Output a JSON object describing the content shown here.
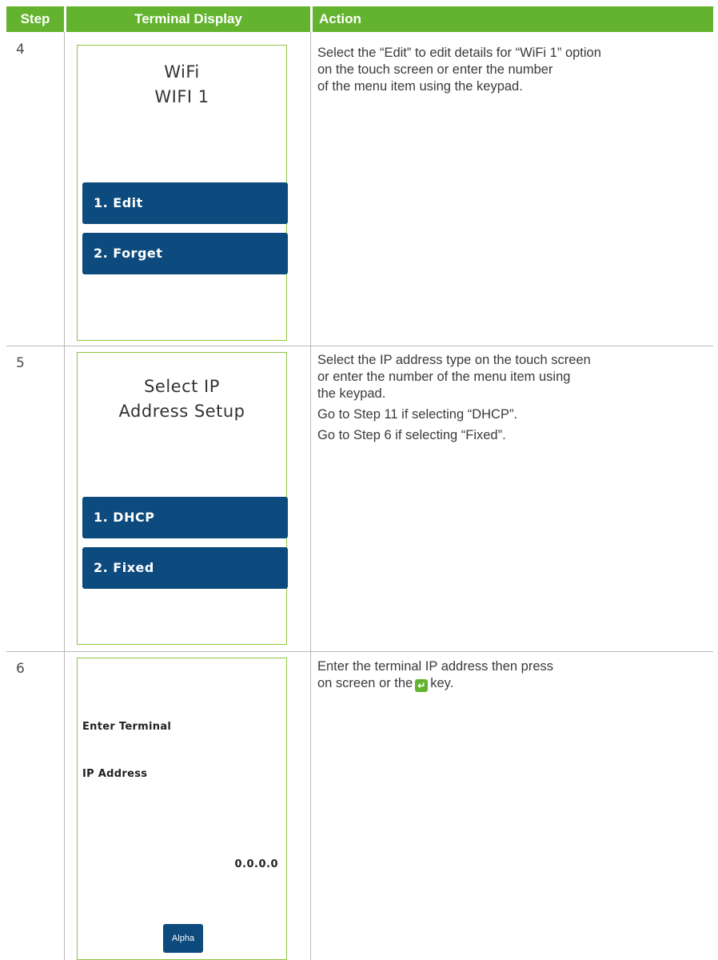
{
  "header": {
    "step": "Step",
    "terminal_display": "Terminal Display",
    "action": "Action"
  },
  "colors": {
    "header_bg": "#63b32e",
    "button_bg": "#0d4a7d",
    "screen_border": "#8cc63f"
  },
  "rows": [
    {
      "step": "4",
      "screen": {
        "title_line1": "WiFi",
        "title_line2": "WIFI 1",
        "options": [
          "1. Edit",
          "2. Forget"
        ]
      },
      "action": {
        "line1": "Select the “Edit” to edit details for “WiFi 1” option",
        "line2": "on the touch screen or enter the number",
        "line3": "of the menu item using the keypad."
      }
    },
    {
      "step": "5",
      "screen": {
        "title_line1": "Select IP",
        "title_line2": "Address Setup",
        "options": [
          "1. DHCP",
          "2. Fixed"
        ]
      },
      "action": {
        "line1": "Select the IP address type on the touch screen",
        "line2": "or enter the number of the menu item using",
        "line3": "the keypad.",
        "para2": "Go to Step 11 if selecting “DHCP”.",
        "para3": "Go to Step 6 if selecting “Fixed”."
      }
    },
    {
      "step": "6",
      "screen": {
        "label1": "Enter Terminal",
        "label2": "IP Address",
        "value": "0.0.0.0",
        "alpha_button": "Alpha"
      },
      "action": {
        "line1": "Enter the terminal IP address then press",
        "line2a": "on screen or the",
        "line2b": "key.",
        "enter_key_icon": "enter-key-icon"
      }
    }
  ]
}
